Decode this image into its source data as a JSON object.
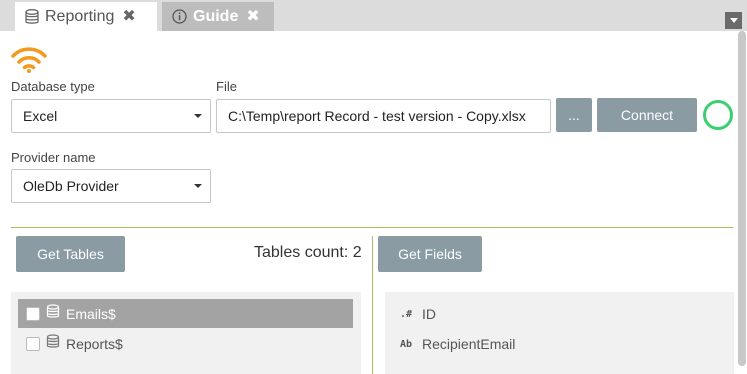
{
  "tabs": [
    {
      "label": "Reporting",
      "icon": "database-icon",
      "active": true
    },
    {
      "label": "Guide",
      "icon": "info-icon",
      "active": false
    }
  ],
  "connection": {
    "status_icon": "wifi-icon",
    "status_color": "#f39a1f",
    "db_type_label": "Database type",
    "db_type_value": "Excel",
    "file_label": "File",
    "file_value": "C:\\Temp\\report Record - test version - Copy.xlsx",
    "browse_label": "...",
    "connect_label": "Connect",
    "connected_indicator_color": "#3ccf72",
    "provider_label": "Provider name",
    "provider_value": "OleDb Provider"
  },
  "tables": {
    "get_tables_label": "Get Tables",
    "count_text": "Tables count: 2",
    "items": [
      {
        "name": "Emails$",
        "selected": true,
        "checked": false
      },
      {
        "name": "Reports$",
        "selected": false,
        "checked": false
      }
    ]
  },
  "fields": {
    "get_fields_label": "Get Fields",
    "items": [
      {
        "type_tag": ".#",
        "name": "ID"
      },
      {
        "type_tag": "Ab",
        "name": "RecipientEmail"
      }
    ]
  },
  "colors": {
    "accent": "#a6c15c",
    "button": "#8a9ba3",
    "selected_row": "#a3a3a3"
  }
}
